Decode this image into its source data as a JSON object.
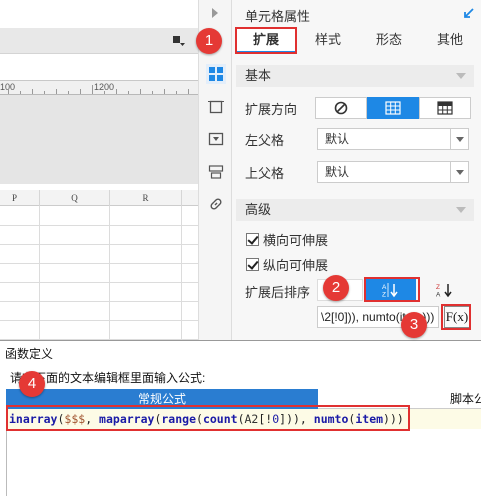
{
  "panel": {
    "title": "单元格属性",
    "tabs": [
      "扩展",
      "样式",
      "形态",
      "其他"
    ],
    "active_tab": "扩展"
  },
  "sections": {
    "basic": "基本",
    "advanced": "高级"
  },
  "basic": {
    "expand_direction_label": "扩展方向",
    "left_parent_label": "左父格",
    "left_parent_value": "默认",
    "top_parent_label": "上父格",
    "top_parent_value": "默认"
  },
  "advanced": {
    "horizontal_expand_label": "横向可伸展",
    "horizontal_expand_checked": true,
    "vertical_expand_label": "纵向可伸展",
    "vertical_expand_checked": true,
    "sort_label": "扩展后排序",
    "formula_preview": "\\2[!0])), numto(item)))",
    "fx_label": "F(x)"
  },
  "sheet": {
    "ruler_labels": [
      "100",
      "1200"
    ],
    "column_headers": [
      "P",
      "Q",
      "R"
    ]
  },
  "dialog": {
    "title": "函数定义",
    "instruction": "请在下面的文本编辑框里面输入公式:",
    "tab_regular": "常规公式",
    "tab_script": "脚本公式",
    "formula": "inarray($$$, maparray(range(count(A2[!0])), numto(item)))"
  },
  "callouts": [
    "1",
    "2",
    "3",
    "4"
  ],
  "colors": {
    "accent": "#1e88e5",
    "callout": "#e53935",
    "dialog_tab": "#2a7dd1",
    "formula_bg": "#fdfbe6"
  },
  "icons": {
    "expand_directions": [
      "no-expand-icon",
      "vertical-expand-icon",
      "horizontal-expand-icon"
    ],
    "sort_options": [
      "no-sort-icon",
      "ascending-sort-icon",
      "descending-sort-icon"
    ],
    "strip": [
      "cell-properties-icon",
      "border-icon",
      "widget-icon",
      "condition-attributes-icon",
      "hyperlink-icon"
    ]
  }
}
